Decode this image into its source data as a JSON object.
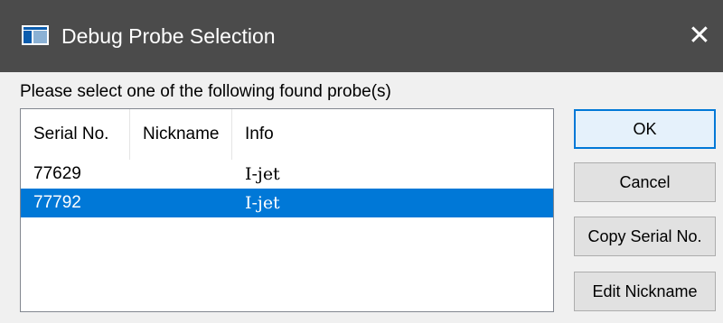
{
  "window": {
    "title": "Debug Probe Selection",
    "app_icon": "application-window-icon",
    "close_glyph": "✕"
  },
  "prompt": "Please select one of the following found probe(s)",
  "list": {
    "columns": [
      "Serial No.",
      "Nickname",
      "Info"
    ],
    "rows": [
      {
        "serial": "77629",
        "nickname": "",
        "info": "I-jet",
        "selected": false
      },
      {
        "serial": "77792",
        "nickname": "",
        "info": "I-jet",
        "selected": true
      }
    ]
  },
  "buttons": {
    "ok": "OK",
    "cancel": "Cancel",
    "copy_serial": "Copy Serial No.",
    "edit_nickname": "Edit Nickname"
  },
  "colors": {
    "titlebar": "#4b4b4b",
    "selection": "#0078d7",
    "default_button_border": "#0078d7"
  }
}
